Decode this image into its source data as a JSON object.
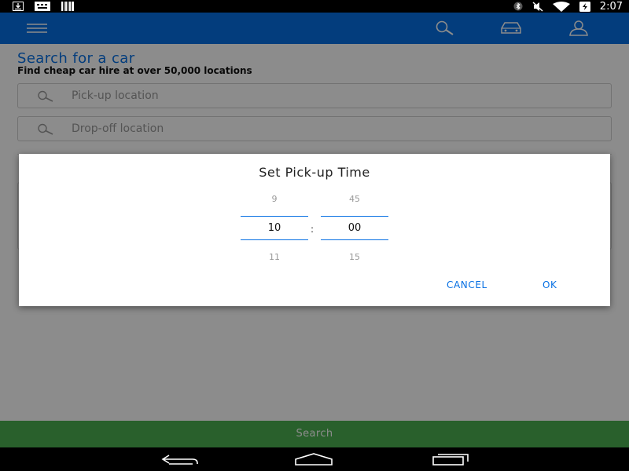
{
  "status_bar": {
    "time": "2:07",
    "left_icons": [
      "download-icon",
      "keyboard-icon",
      "barcode-icon"
    ],
    "right_icons": [
      "bluetooth-icon",
      "mute-icon",
      "wifi-icon",
      "battery-charging-icon"
    ]
  },
  "app_bar": {
    "color": "#0770e3",
    "icons": [
      "menu-icon",
      "search-icon",
      "car-icon",
      "profile-icon"
    ]
  },
  "page": {
    "title": "Search for a car",
    "subtitle": "Find cheap car hire at over 50,000 locations",
    "pickup": {
      "placeholder": "Pick-up location",
      "value": ""
    },
    "dropoff": {
      "placeholder": "Drop-off location",
      "value": ""
    }
  },
  "dialog": {
    "title": "Set Pick-up Time",
    "hours": {
      "prev": "9",
      "selected": "10",
      "next": "11"
    },
    "separator": ":",
    "minutes": {
      "prev": "45",
      "selected": "00",
      "next": "15"
    },
    "cancel_label": "CANCEL",
    "ok_label": "OK",
    "accent": "#0770e3"
  },
  "search_button": {
    "label": "Search",
    "color": "#4caf50"
  },
  "nav_bar": {
    "icons": [
      "back-icon",
      "home-icon",
      "recent-apps-icon"
    ]
  }
}
